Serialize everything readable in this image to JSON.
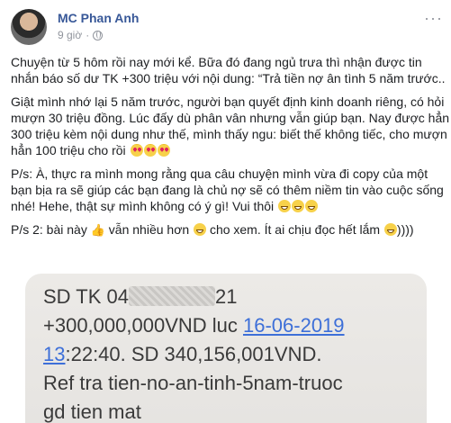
{
  "post": {
    "author": "MC Phan Anh",
    "time": "9 giờ",
    "privacy_icon": "globe-icon",
    "para1_line1": "Chuyện từ 5 hôm rồi nay mới kể. Bữa đó đang ngủ trưa thì nhận được tin",
    "para1_line2": "nhắn báo số dư TK +300 triệu với nội dung: “Trả tiền nợ ân tình 5 năm trước..",
    "para2_line1": "Giật mình nhớ lại 5 năm trước, người bạn quyết định kinh doanh riêng, có hỏi",
    "para2_line2": "mượn 30 triệu đồng. Lúc đấy dù phân vân nhưng vẫn giúp bạn. Nay được hẳn",
    "para2_line3": "300 triệu kèm nội dung như thế, mình thấy ngu: biết thế không tiếc, cho mượn",
    "para2_line4": "hẳn 100 triệu cho rồi",
    "para3_line1": "P/s: À, thực ra mình mong rằng qua câu chuyện mình vừa đi copy của một",
    "para3_line2": "bạn bịa ra sẽ giúp các bạn đang là chủ nợ sẽ có thêm niềm tin vào cuộc sống",
    "para3_line3": "nhé! Hehe, thật sự mình không có ý gì! Vui thôi",
    "para4_a": "P/s 2: bài này",
    "para4_b": "vẫn nhiều hơn",
    "para4_c": "cho xem. Ít ai chịu đọc hết lắm",
    "para4_d": "))))"
  },
  "sms": {
    "line1_a": "SD TK 04",
    "line1_b": "21",
    "line2_a": "+300,000,000VND luc ",
    "line2_date": "16-06-2019",
    "line3_time": "13",
    "line3_b": ":22:40. SD 340,156,001VND.",
    "line4": "Ref tra tien-no-an-tinh-5nam-truoc",
    "line5": "gd tien mat"
  }
}
